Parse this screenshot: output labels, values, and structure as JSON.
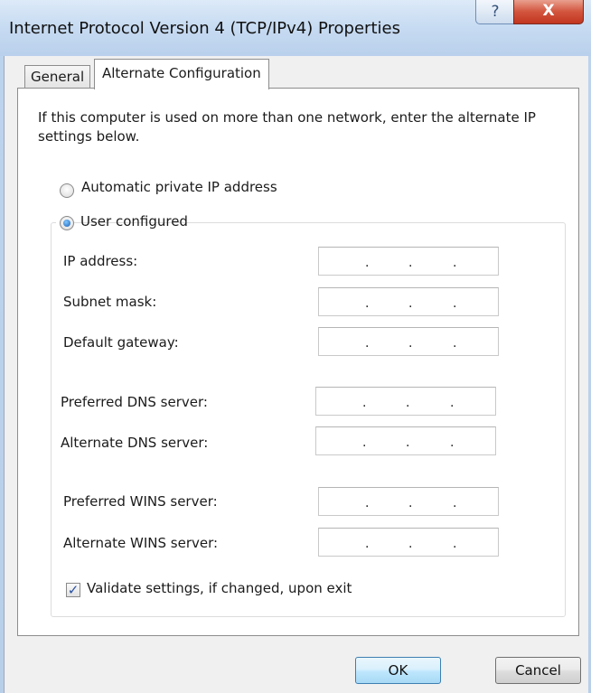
{
  "window": {
    "title": "Internet Protocol Version 4 (TCP/IPv4) Properties",
    "help_glyph": "?",
    "close_glyph": "X"
  },
  "tabs": [
    {
      "label": "General",
      "selected": false
    },
    {
      "label": "Alternate Configuration",
      "selected": true
    }
  ],
  "alternate": {
    "intro": "If this computer is used on more than one network, enter the alternate IP settings below.",
    "radio_auto_label": "Automatic private IP address",
    "radio_user_label": "User configured",
    "selected_option": "User configured",
    "fields": {
      "ip_address": {
        "label": "IP address:",
        "value": ". . ."
      },
      "subnet_mask": {
        "label": "Subnet mask:",
        "value": ". . ."
      },
      "default_gateway": {
        "label": "Default gateway:",
        "value": ". . ."
      },
      "preferred_dns": {
        "label": "Preferred DNS server:",
        "value": ". . ."
      },
      "alternate_dns": {
        "label": "Alternate DNS server:",
        "value": ". . ."
      },
      "preferred_wins": {
        "label": "Preferred WINS server:",
        "value": ". . ."
      },
      "alternate_wins": {
        "label": "Alternate WINS server:",
        "value": ". . ."
      }
    },
    "validate_label": "Validate settings, if changed, upon exit",
    "validate_checked": true,
    "checkmark_glyph": "✓",
    "ip_dot": "."
  },
  "buttons": {
    "ok_label": "OK",
    "cancel_label": "Cancel"
  },
  "colors": {
    "close_button": "#c2361f",
    "radio_selected": "#1a5fb4",
    "default_button_border": "#3c7fb1"
  }
}
